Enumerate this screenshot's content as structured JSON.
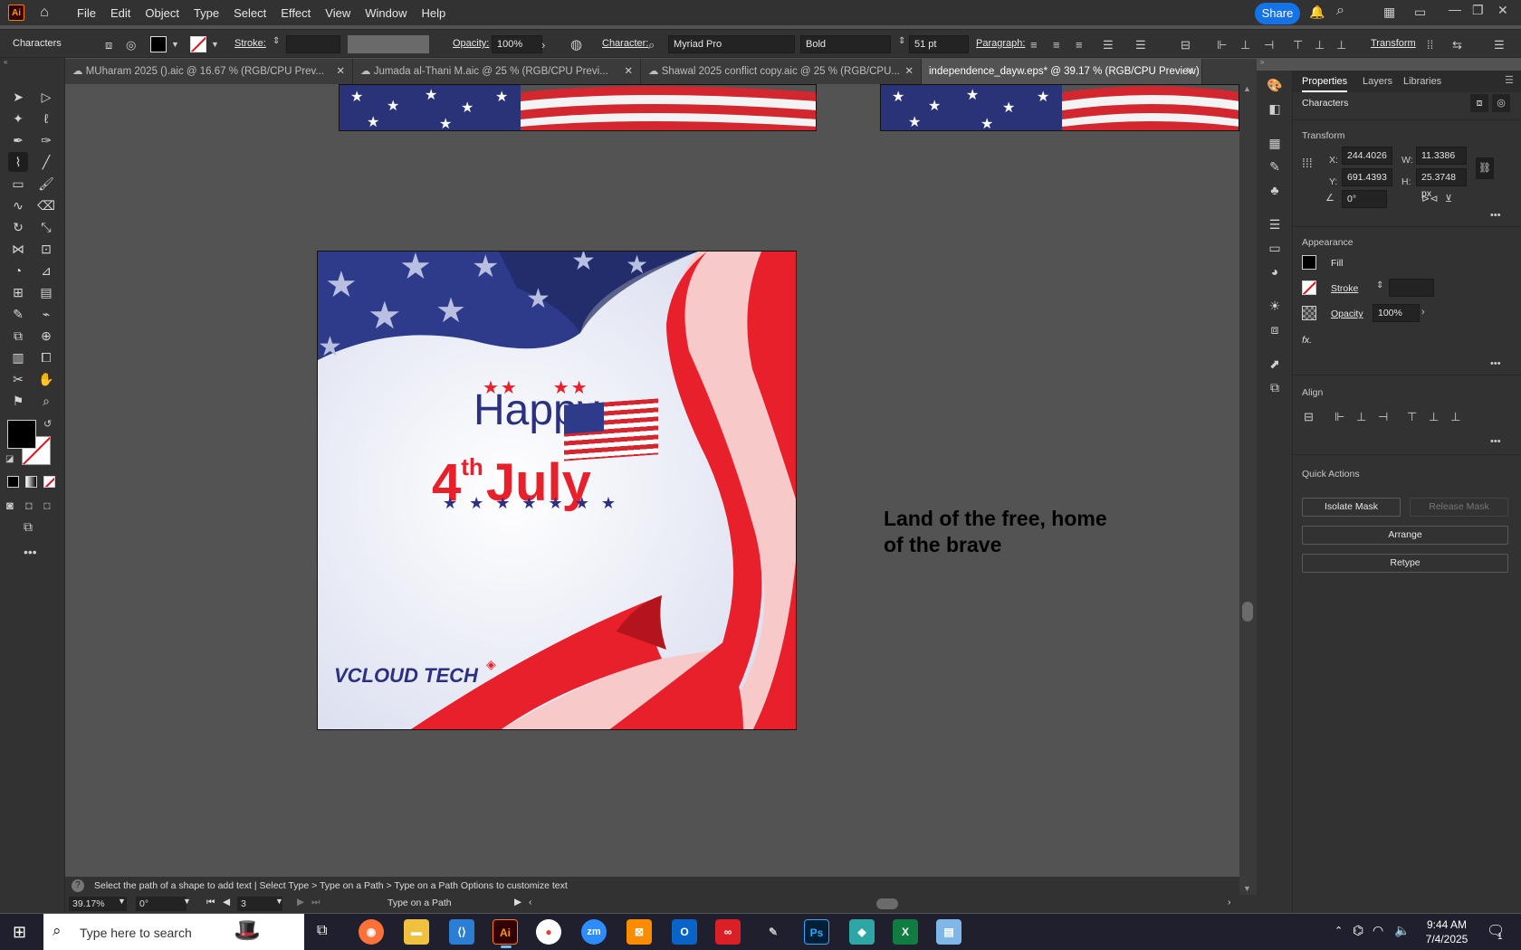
{
  "app": {
    "logo": "Ai",
    "menu": [
      "File",
      "Edit",
      "Object",
      "Type",
      "Select",
      "Effect",
      "View",
      "Window",
      "Help"
    ],
    "share_label": "Share"
  },
  "control_bar": {
    "panel_label": "Characters",
    "stroke_label": "Stroke:",
    "opacity_label": "Opacity:",
    "opacity_value": "100%",
    "character_label": "Character:",
    "font_family": "Myriad Pro",
    "font_style": "Bold",
    "font_size": "51 pt",
    "paragraph_label": "Paragraph:",
    "transform_label": "Transform"
  },
  "tabs": [
    {
      "label": "MUharam 2025 ().aic @ 16.67 % (RGB/CPU Prev...",
      "active": false
    },
    {
      "label": "Jumada al-Thani M.aic @ 25 % (RGB/CPU Previ...",
      "active": false
    },
    {
      "label": "Shawal 2025 conflict copy.aic @ 25 % (RGB/CPU...",
      "active": false
    },
    {
      "label": "independence_dayw.eps* @ 39.17 % (RGB/CPU Preview)",
      "active": true
    }
  ],
  "artboard": {
    "happy": "Happy",
    "fourth_number": "4",
    "fourth_suffix": "th",
    "july": "July",
    "logo_text": "VCLOUD TECH"
  },
  "canvas_text": {
    "line1": "Land of the free, home",
    "line2": "of the brave"
  },
  "properties": {
    "tabs": [
      "Properties",
      "Layers",
      "Libraries"
    ],
    "object_type": "Characters",
    "transform_title": "Transform",
    "x_label": "X:",
    "x_value": "244.4026 p",
    "y_label": "Y:",
    "y_value": "691.4393 p",
    "w_label": "W:",
    "w_value": "11.3386 px",
    "h_label": "H:",
    "h_value": "25.3748 px",
    "angle_value": "0°",
    "appearance_title": "Appearance",
    "fill_label": "Fill",
    "stroke_label": "Stroke",
    "opacity_label": "Opacity",
    "opacity_value": "100%",
    "fx_label": "fx.",
    "align_title": "Align",
    "quick_actions_title": "Quick Actions",
    "isolate_mask": "Isolate Mask",
    "release_mask": "Release Mask",
    "arrange": "Arrange",
    "retype": "Retype"
  },
  "status": {
    "hint": "Select the path of a shape to add text  |  Select Type > Type on a Path > Type on a Path Options to customize text",
    "zoom": "39.17%",
    "rotation": "0°",
    "artboard_num": "3",
    "tool_name": "Type on a Path"
  },
  "taskbar": {
    "search_placeholder": "Type here to search",
    "time": "9:44 AM",
    "date": "7/4/2025",
    "notification_count": "1"
  },
  "colors": {
    "accent_blue": "#1473e6",
    "flag_red": "#e8202c",
    "flag_navy": "#2b3180",
    "ui_dark": "#323232",
    "canvas_gray": "#535353"
  }
}
